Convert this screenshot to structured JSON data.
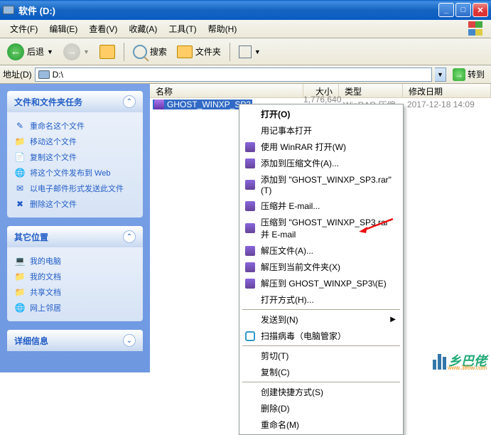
{
  "window": {
    "title": "软件 (D:)"
  },
  "menu": {
    "file": "文件(F)",
    "edit": "编辑(E)",
    "view": "查看(V)",
    "favorites": "收藏(A)",
    "tools": "工具(T)",
    "help": "帮助(H)"
  },
  "toolbar": {
    "back": "后退",
    "search": "搜索",
    "folders": "文件夹"
  },
  "address": {
    "label": "地址(D)",
    "value": "D:\\",
    "go": "转到"
  },
  "sidebar": {
    "tasks": {
      "title": "文件和文件夹任务",
      "items": [
        "重命名这个文件",
        "移动这个文件",
        "复制这个文件",
        "将这个文件发布到 Web",
        "以电子邮件形式发送此文件",
        "删除这个文件"
      ]
    },
    "places": {
      "title": "其它位置",
      "items": [
        "我的电脑",
        "我的文档",
        "共享文档",
        "网上邻居"
      ]
    },
    "details": {
      "title": "详细信息"
    }
  },
  "columns": {
    "name": "名称",
    "size": "大小",
    "type": "类型",
    "date": "修改日期"
  },
  "file": {
    "name": "GHOST_WINXP_SP3",
    "size": "1,776,640 KB",
    "type": "WinRAR 压缩",
    "date": "2017-12-18 14:09"
  },
  "context": {
    "open": "打开(O)",
    "notepad": "用记事本打开",
    "winrar": "使用 WinRAR 打开(W)",
    "addarchive": "添加到压缩文件(A)...",
    "addto": "添加到 \"GHOST_WINXP_SP3.rar\"(T)",
    "email": "压缩并 E-mail...",
    "emailto": "压缩到 \"GHOST_WINXP_SP3.rar\" 并 E-mail",
    "extract": "解压文件(A)...",
    "extracthere": "解压到当前文件夹(X)",
    "extractto": "解压到 GHOST_WINXP_SP3\\(E)",
    "openwith": "打开方式(H)...",
    "sendto": "发送到(N)",
    "scan": "扫描病毒（电脑管家）",
    "cut": "剪切(T)",
    "copy": "复制(C)",
    "shortcut": "创建快捷方式(S)",
    "delete": "删除(D)",
    "rename": "重命名(M)"
  },
  "watermark": {
    "text": "乡巴佬",
    "url": "www.386w.com"
  }
}
